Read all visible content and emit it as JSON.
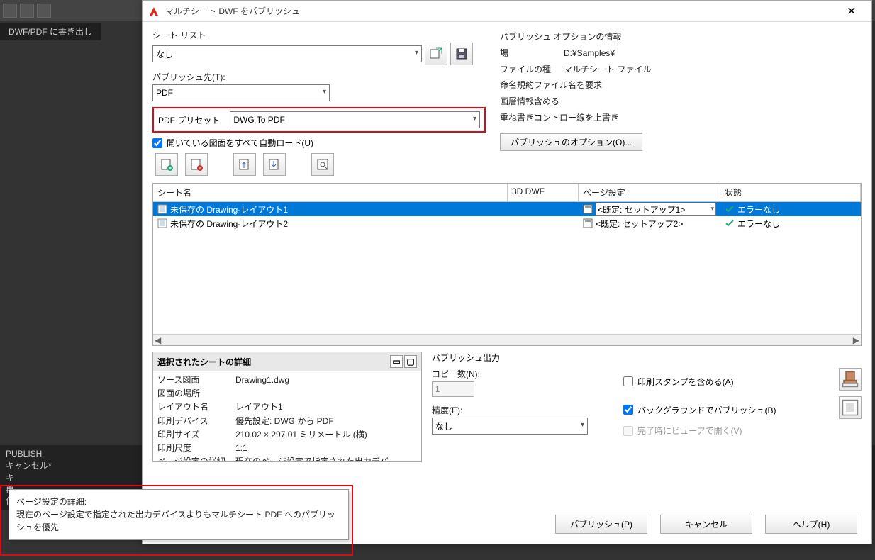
{
  "bg": {
    "ribbon_tab": "DWF/PDF に書き出し",
    "cmd_lines": [
      "PUBLISH",
      "キャンセル*",
      "キ",
      "再",
      "作"
    ]
  },
  "dialog": {
    "title": "マルチシート DWF をパブリッシュ",
    "sheet_list_label": "シート リスト",
    "sheet_list_value": "なし",
    "publish_to_label": "パブリッシュ先(T):",
    "publish_to_value": "PDF",
    "pdf_preset_label": "PDF プリセット",
    "pdf_preset_value": "DWG To PDF",
    "autoload_label": "開いている図面をすべて自動ロード(U)",
    "info_title": "パブリッシュ オプションの情報",
    "info_location_k": "場",
    "info_location_v": "D:¥Samples¥",
    "info_filetype_k": "ファイルの種",
    "info_filetype_v": "マルチシート ファイル",
    "info_naming": "命名規約ファイル名を要求",
    "info_layer": "画層情報含める",
    "info_merge_k": "重ね書きコントロー",
    "info_merge_v": "線を上書き",
    "options_btn": "パブリッシュのオプション(O)...",
    "table": {
      "h1": "シート名",
      "h2": "3D DWF",
      "h3": "ページ設定",
      "h4": "状態",
      "rows": [
        {
          "name": "未保存の Drawing-レイアウト1",
          "page_setup": "<既定: セットアップ1>",
          "status": "エラーなし",
          "selected": true
        },
        {
          "name": "未保存の Drawing-レイアウト2",
          "page_setup": "<既定: セットアップ2>",
          "status": "エラーなし",
          "selected": false
        }
      ]
    },
    "details": {
      "title": "選択されたシートの詳細",
      "rows": [
        {
          "k": "ソース図面",
          "v": "Drawing1.dwg"
        },
        {
          "k": "図面の場所",
          "v": ""
        },
        {
          "k": "レイアウト名",
          "v": "レイアウト1"
        },
        {
          "k": "印刷デバイス",
          "v": "優先設定: DWG から PDF"
        },
        {
          "k": "印刷サイズ",
          "v": "210.02 × 297.01 ミリメートル (横)"
        },
        {
          "k": "印刷尺度",
          "v": "1:1"
        },
        {
          "k": "ページ設定の詳細",
          "v": "現在のページ設定で指定された出力デバ..."
        }
      ]
    },
    "output": {
      "title": "パブリッシュ出力",
      "copies_label": "コピー数(N):",
      "copies_value": "1",
      "precision_label": "精度(E):",
      "precision_value": "なし",
      "stamp_label": "印刷スタンプを含める(A)",
      "bg_label": "バックグラウンドでパブリッシュ(B)",
      "viewer_label": "完了時にビューアで開く(V)"
    },
    "footer": {
      "publish": "パブリッシュ(P)",
      "cancel": "キャンセル",
      "help": "ヘルプ(H)"
    }
  },
  "tooltip": {
    "title": "ページ設定の詳細:",
    "body": "現在のページ設定で指定された出力デバイスよりもマルチシート PDF へのパブリッシュを優先"
  }
}
